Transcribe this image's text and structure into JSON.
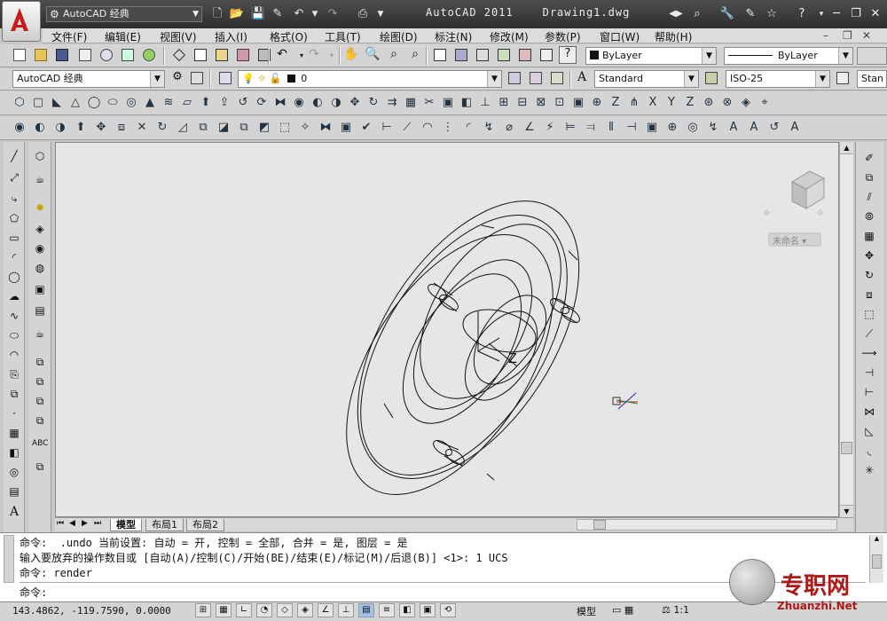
{
  "app": {
    "title": "AutoCAD 2011",
    "document": "Drawing1.dwg",
    "workspace": "AutoCAD 经典"
  },
  "menu": [
    "文件(F)",
    "编辑(E)",
    "视图(V)",
    "插入(I)",
    "格式(O)",
    "工具(T)",
    "绘图(D)",
    "标注(N)",
    "修改(M)",
    "参数(P)",
    "窗口(W)",
    "帮助(H)"
  ],
  "toolbar": {
    "color": "ByLayer",
    "linetype": "ByLayer",
    "workspace": "AutoCAD 经典",
    "layer": "0",
    "text_style": "Standard",
    "dim_style": "ISO-25",
    "table_style": "Stan"
  },
  "viewcube": {
    "label": "未命名"
  },
  "tabs": [
    "模型",
    "布局1",
    "布局2"
  ],
  "command": {
    "lines": [
      "命令:  .undo 当前设置: 自动 = 开, 控制 = 全部, 合并 = 是, 图层 = 是",
      "输入要放弃的操作数目或 [自动(A)/控制(C)/开始(BE)/结束(E)/标记(M)/后退(B)] <1>: 1 UCS",
      "命令: render"
    ],
    "prompt": "命令:"
  },
  "status": {
    "coords": "143.4862, -119.7590, 0.0000",
    "model": "模型",
    "scale": "1:1"
  },
  "watermark": {
    "text": "专职网",
    "url": "Zhuanzhi.Net"
  },
  "axis_label": "Z",
  "colors": {
    "titlebar": "#3a3a3a",
    "canvas": "#e6e6e6",
    "accent_red": "#cc2020"
  }
}
